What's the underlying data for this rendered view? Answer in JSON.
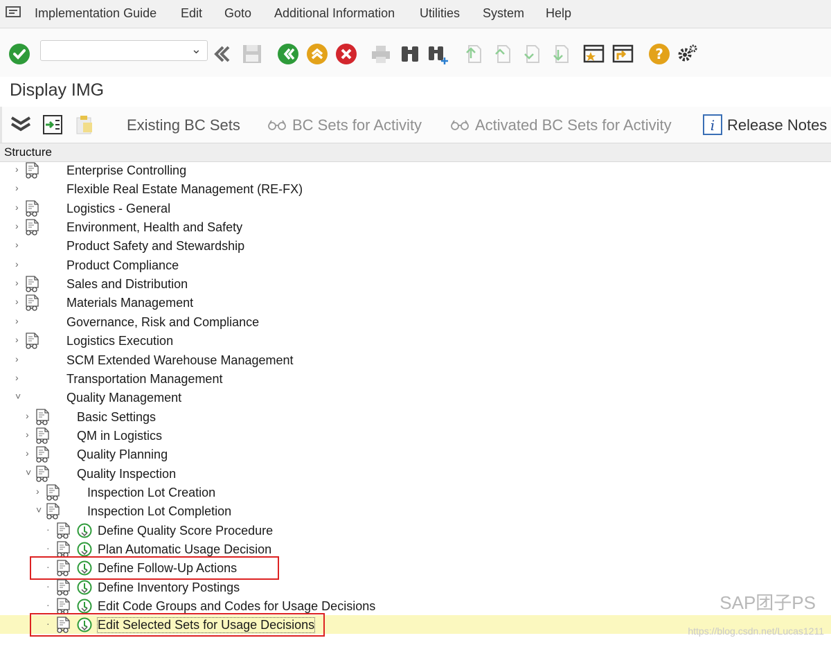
{
  "menu": [
    "Implementation Guide",
    "Edit",
    "Goto",
    "Additional Information",
    "Utilities",
    "System",
    "Help"
  ],
  "title": "Display IMG",
  "toolbar2": {
    "existing": "Existing BC Sets",
    "for_activity": "BC Sets for Activity",
    "activated": "Activated BC Sets for Activity",
    "release": "Release Notes"
  },
  "structure_header": "Structure",
  "tree": [
    {
      "label": "Enterprise Controlling",
      "caret": "›",
      "doc": true,
      "act": false,
      "depth": 0
    },
    {
      "label": "Flexible Real Estate Management (RE-FX)",
      "caret": "›",
      "doc": false,
      "act": false,
      "depth": 0
    },
    {
      "label": "Logistics - General",
      "caret": "›",
      "doc": true,
      "act": false,
      "depth": 0
    },
    {
      "label": "Environment, Health and Safety",
      "caret": "›",
      "doc": true,
      "act": false,
      "depth": 0
    },
    {
      "label": "Product Safety and Stewardship",
      "caret": "›",
      "doc": false,
      "act": false,
      "depth": 0
    },
    {
      "label": "Product Compliance",
      "caret": "›",
      "doc": false,
      "act": false,
      "depth": 0
    },
    {
      "label": "Sales and Distribution",
      "caret": "›",
      "doc": true,
      "act": false,
      "depth": 0
    },
    {
      "label": "Materials Management",
      "caret": "›",
      "doc": true,
      "act": false,
      "depth": 0
    },
    {
      "label": "Governance, Risk and Compliance",
      "caret": "›",
      "doc": false,
      "act": false,
      "depth": 0
    },
    {
      "label": "Logistics Execution",
      "caret": "›",
      "doc": true,
      "act": false,
      "depth": 0
    },
    {
      "label": "SCM Extended Warehouse Management",
      "caret": "›",
      "doc": false,
      "act": false,
      "depth": 0
    },
    {
      "label": "Transportation Management",
      "caret": "›",
      "doc": false,
      "act": false,
      "depth": 0
    },
    {
      "label": "Quality Management",
      "caret": "˅",
      "doc": false,
      "act": false,
      "depth": 0
    },
    {
      "label": "Basic Settings",
      "caret": "›",
      "doc": true,
      "act": false,
      "depth": 1
    },
    {
      "label": "QM in Logistics",
      "caret": "›",
      "doc": true,
      "act": false,
      "depth": 1
    },
    {
      "label": "Quality Planning",
      "caret": "›",
      "doc": true,
      "act": false,
      "depth": 1
    },
    {
      "label": "Quality Inspection",
      "caret": "˅",
      "doc": true,
      "act": false,
      "depth": 1
    },
    {
      "label": "Inspection Lot Creation",
      "caret": "›",
      "doc": true,
      "act": false,
      "depth": 2
    },
    {
      "label": "Inspection Lot Completion",
      "caret": "˅",
      "doc": true,
      "act": false,
      "depth": 2
    },
    {
      "label": "Define Quality Score Procedure",
      "caret": "·",
      "doc": true,
      "act": true,
      "depth": 3
    },
    {
      "label": "Plan Automatic Usage Decision",
      "caret": "·",
      "doc": true,
      "act": true,
      "depth": 3
    },
    {
      "label": "Define Follow-Up Actions",
      "caret": "·",
      "doc": true,
      "act": true,
      "depth": 3,
      "boxed": true
    },
    {
      "label": "Define Inventory Postings",
      "caret": "·",
      "doc": true,
      "act": true,
      "depth": 3
    },
    {
      "label": "Edit Code Groups and Codes for Usage Decisions",
      "caret": "·",
      "doc": true,
      "act": true,
      "depth": 3
    },
    {
      "label": "Edit Selected Sets for Usage Decisions",
      "caret": "·",
      "doc": true,
      "act": true,
      "depth": 3,
      "boxed": true,
      "highlight": true
    }
  ],
  "watermark": {
    "brand": "SAP团子PS",
    "url": "https://blog.csdn.net/Lucas1211"
  }
}
